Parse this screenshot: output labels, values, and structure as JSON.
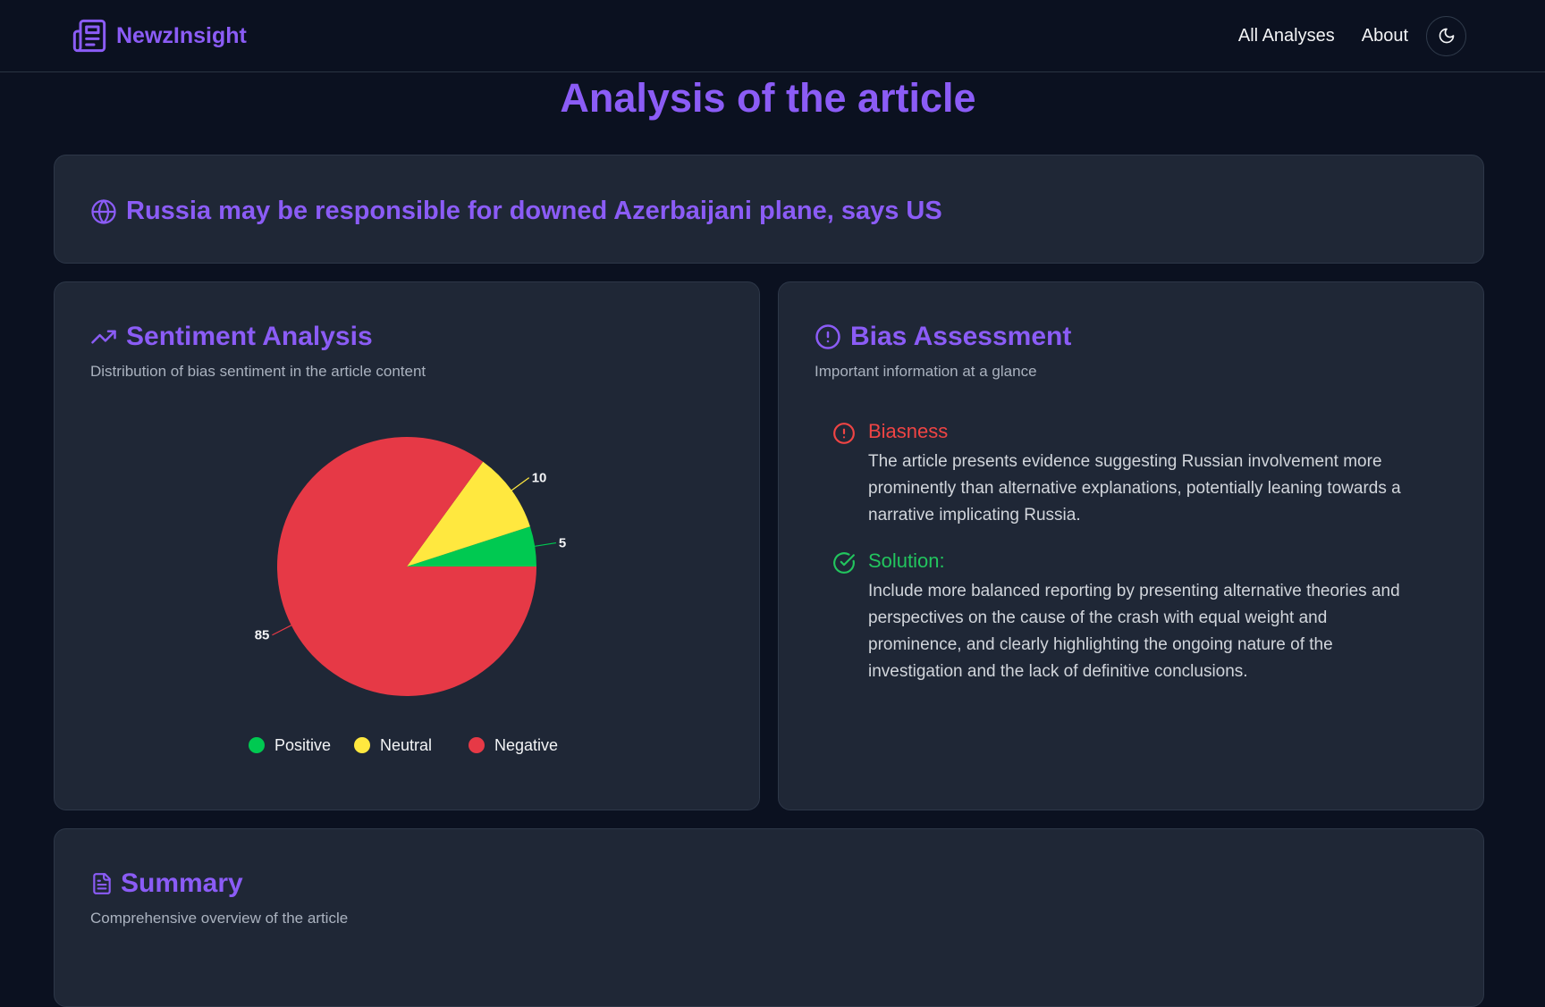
{
  "app": {
    "name": "NewzInsight"
  },
  "nav": {
    "links": [
      "All Analyses",
      "About"
    ],
    "theme_icon": "moon-icon"
  },
  "page": {
    "title": "Analysis of the article"
  },
  "article": {
    "headline": "Russia may be responsible for downed Azerbaijani plane, says US"
  },
  "sentiment": {
    "title": "Sentiment Analysis",
    "subtitle": "Distribution of bias sentiment in the article content"
  },
  "bias": {
    "title": "Bias Assessment",
    "subtitle": "Important information at a glance",
    "biasness_label": "Biasness",
    "biasness_text": "The article presents evidence suggesting Russian involvement more prominently than alternative explanations, potentially leaning towards a narrative implicating Russia.",
    "solution_label": "Solution:",
    "solution_text": "Include more balanced reporting by presenting alternative theories and perspectives on the cause of the crash with equal weight and prominence, and clearly highlighting the ongoing nature of the investigation and the lack of definitive conclusions."
  },
  "summary": {
    "title": "Summary",
    "subtitle": "Comprehensive overview of the article"
  },
  "colors": {
    "accent": "#8b5cf6",
    "positive": "#00c951",
    "neutral": "#ffe83f",
    "negative": "#e63946",
    "danger": "#ef4444",
    "success": "#22c55e"
  },
  "chart_data": {
    "type": "pie",
    "categories": [
      "Positive",
      "Neutral",
      "Negative"
    ],
    "values": [
      5,
      10,
      85
    ],
    "colors": [
      "#00c951",
      "#ffe83f",
      "#e63946"
    ],
    "legend": "bottom"
  }
}
